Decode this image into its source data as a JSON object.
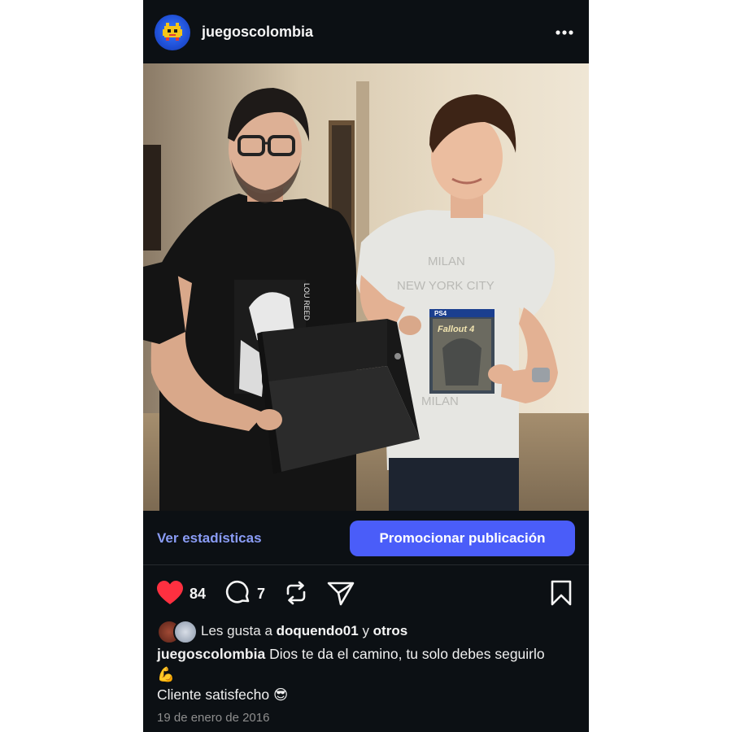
{
  "header": {
    "username": "juegoscolombia",
    "avatar_icon": "pixel-invader-icon",
    "more_icon": "more-horizontal-icon"
  },
  "photo": {
    "game_box_brand": "PS4",
    "game_title": "Fallout 4",
    "shirt_print_lines": [
      "MILAN",
      "NEW YORK CITY",
      "MILAN"
    ],
    "shirt_print_left": "LOU REED"
  },
  "promo": {
    "stats_label": "Ver estadísticas",
    "promote_label": "Promocionar publicación"
  },
  "actions": {
    "like_count": "84",
    "comment_count": "7",
    "like_icon": "heart-filled-icon",
    "comment_icon": "comment-icon",
    "repost_icon": "repost-icon",
    "share_icon": "send-icon",
    "save_icon": "bookmark-icon"
  },
  "likes": {
    "prefix": "Les gusta a",
    "user": "doquendo01",
    "connector": "y",
    "others": "otros"
  },
  "caption": {
    "username": "juegoscolombia",
    "line1": "Dios te da el camino, tu solo debes seguirlo",
    "emoji1": "💪",
    "line2": "Cliente satisfecho",
    "emoji2": "😎"
  },
  "date": "19 de enero de 2016",
  "colors": {
    "background": "#0c1014",
    "accent": "#4a5df9",
    "link": "#8a9cf5",
    "like": "#ff3040"
  }
}
